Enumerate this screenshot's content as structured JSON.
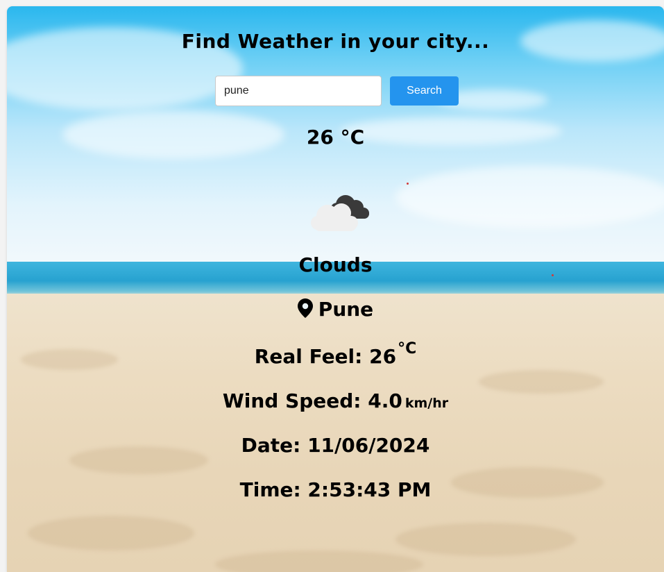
{
  "heading": "Find Weather in your city...",
  "search": {
    "value": "pune",
    "placeholder": "",
    "button_label": "Search"
  },
  "weather": {
    "temperature": "26 °C",
    "icon": "cloud-icon",
    "condition": "Clouds",
    "location_icon": "map-pin-icon",
    "city": "Pune",
    "real_feel_label": "Real Feel: 26",
    "real_feel_unit": "°C",
    "wind_label": "Wind Speed: 4.0",
    "wind_unit": "km/hr",
    "date": "Date: 11/06/2024",
    "time": "Time: 2:53:43 PM"
  },
  "colors": {
    "button": "#2494ee",
    "text": "#000000",
    "sky": "#2ab7ee",
    "sand": "#ecdcc1"
  }
}
